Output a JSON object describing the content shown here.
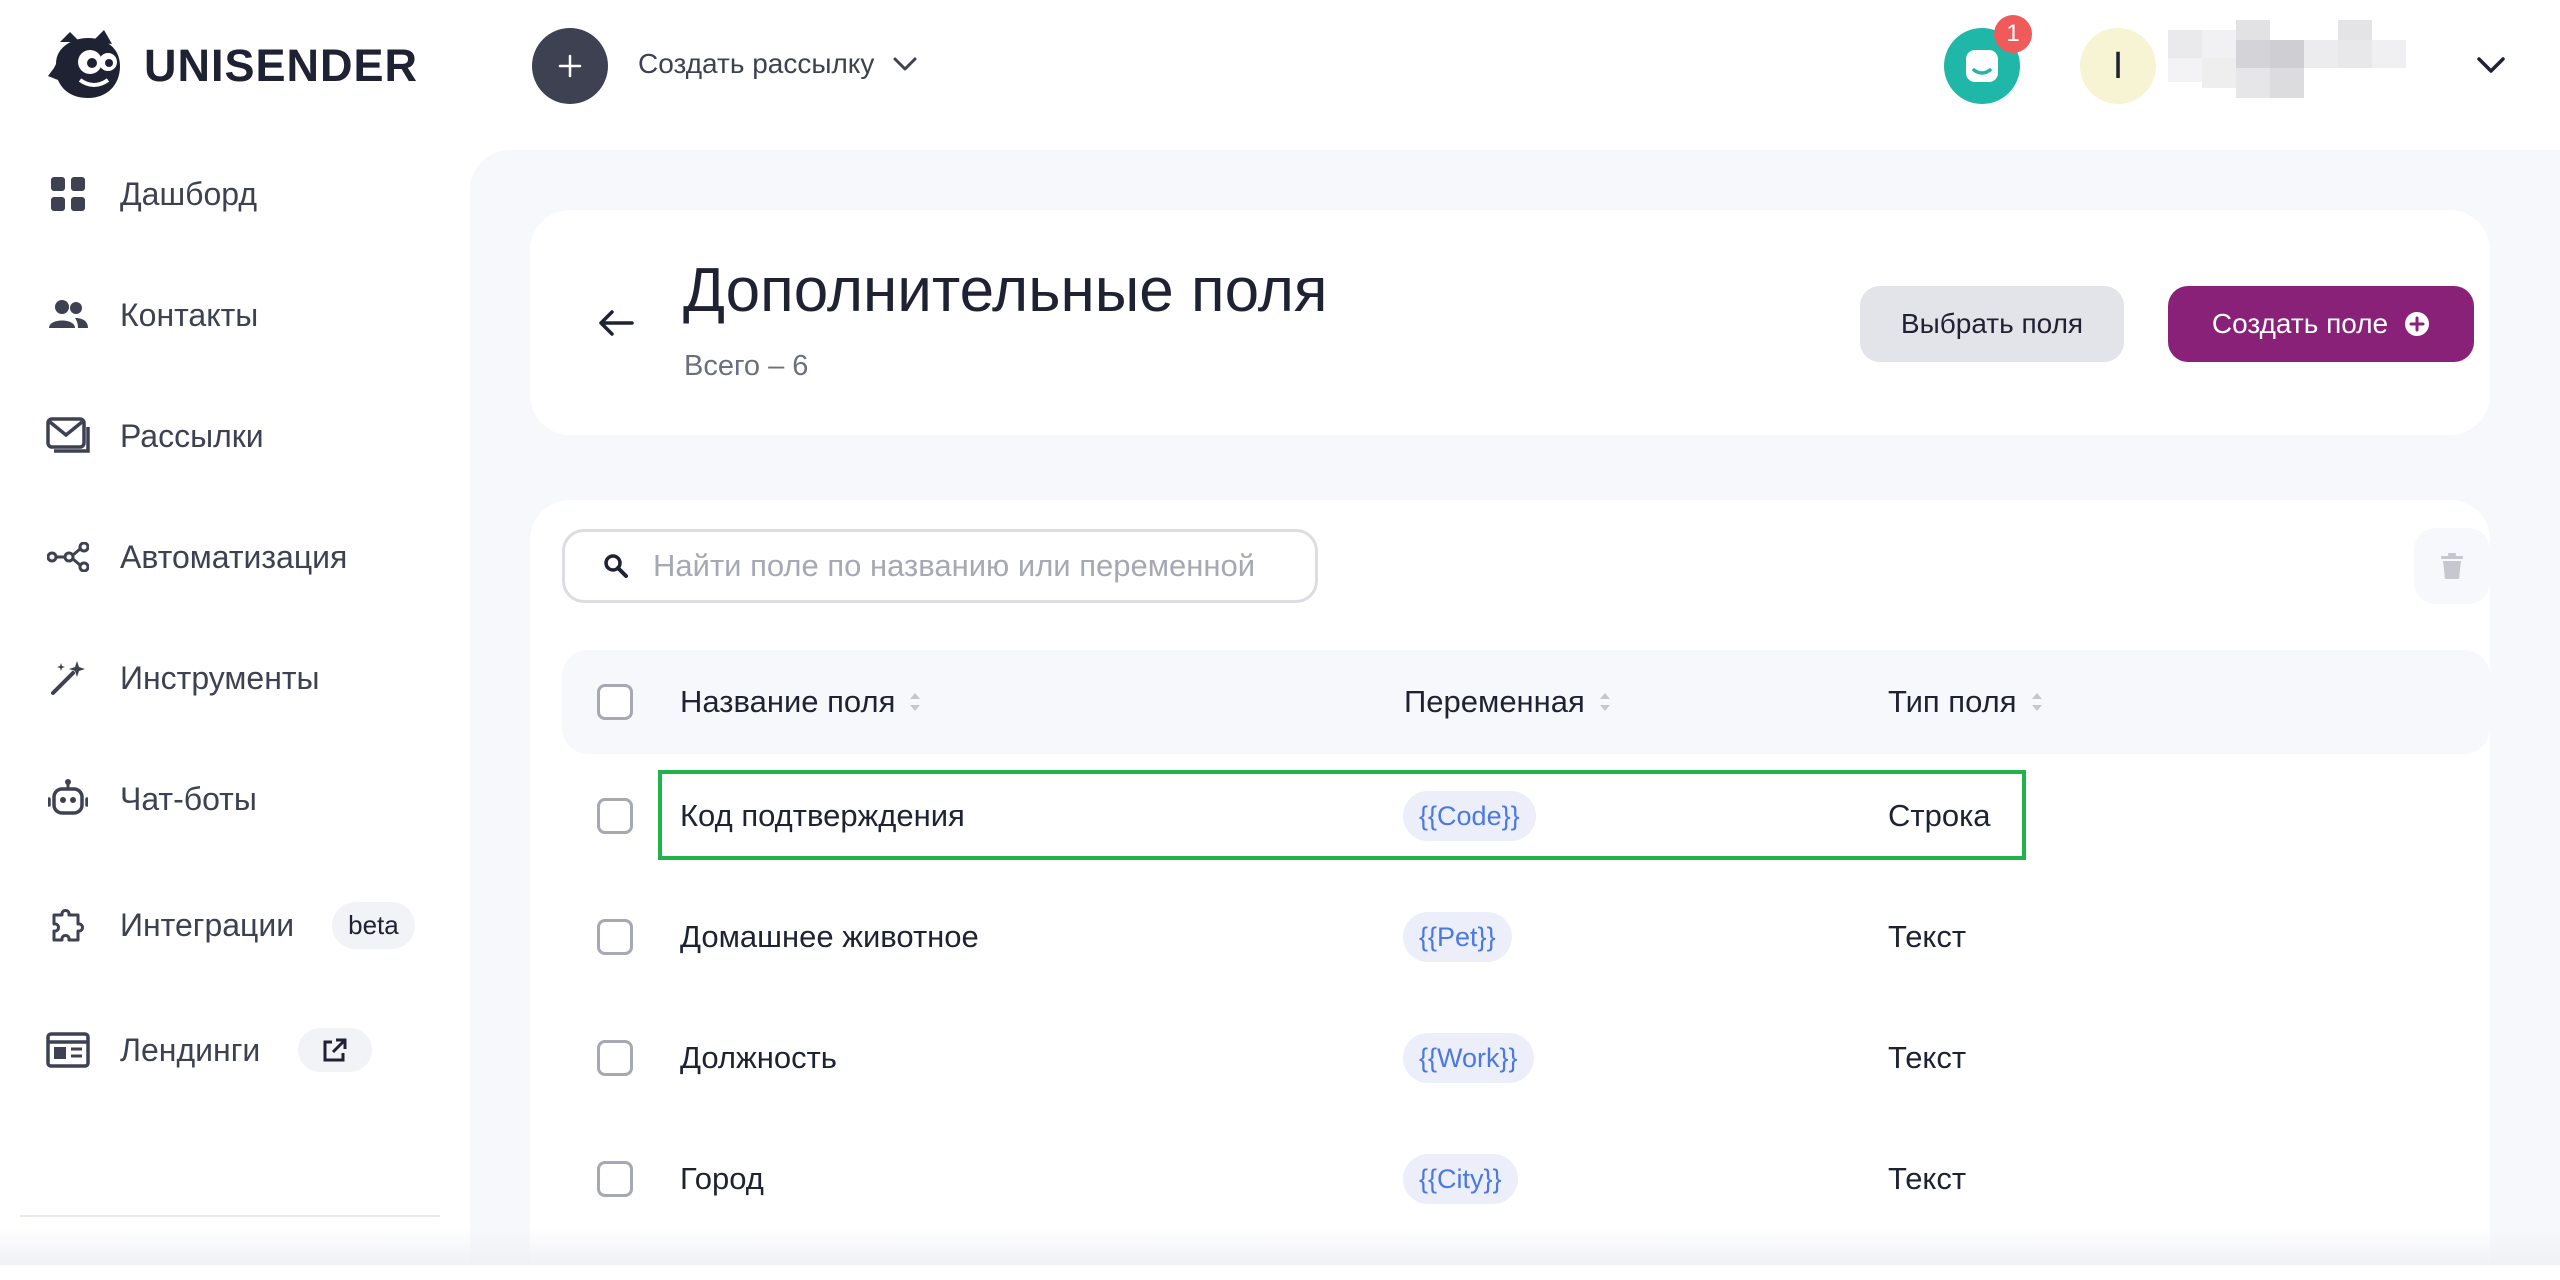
{
  "app": {
    "logo_text": "UNISENDER"
  },
  "topbar": {
    "create_label": "Создать рассылку",
    "notification_count": "1",
    "avatar_initial": "I"
  },
  "sidebar": {
    "items": [
      {
        "label": "Дашборд",
        "icon": "dashboard-icon"
      },
      {
        "label": "Контакты",
        "icon": "contacts-icon"
      },
      {
        "label": "Рассылки",
        "icon": "mail-icon"
      },
      {
        "label": "Автоматизация",
        "icon": "automation-icon"
      },
      {
        "label": "Инструменты",
        "icon": "magic-wand-icon"
      },
      {
        "label": "Чат-боты",
        "icon": "bot-icon"
      },
      {
        "label": "Интеграции",
        "icon": "puzzle-icon",
        "badge": "beta"
      },
      {
        "label": "Лендинги",
        "icon": "landing-icon",
        "badge_icon": "external-link-icon"
      }
    ]
  },
  "page": {
    "title": "Дополнительные поля",
    "subtitle": "Всего – 6",
    "select_fields_label": "Выбрать поля",
    "create_field_label": "Создать поле"
  },
  "search": {
    "placeholder": "Найти поле по названию или переменной"
  },
  "table": {
    "columns": [
      "Название поля",
      "Переменная",
      "Тип поля"
    ],
    "rows": [
      {
        "name": "Код подтверждения",
        "variable": "{{Code}}",
        "type": "Строка",
        "highlighted": true
      },
      {
        "name": "Домашнее животное",
        "variable": "{{Pet}}",
        "type": "Текст"
      },
      {
        "name": "Должность",
        "variable": "{{Work}}",
        "type": "Текст"
      },
      {
        "name": "Город",
        "variable": "{{City}}",
        "type": "Текст"
      }
    ]
  },
  "colors": {
    "primary": "#8a2178",
    "support": "#1fb7a8",
    "badge": "#ef5b5b",
    "highlight": "#22b24c",
    "chip_text": "#4b79e0"
  }
}
